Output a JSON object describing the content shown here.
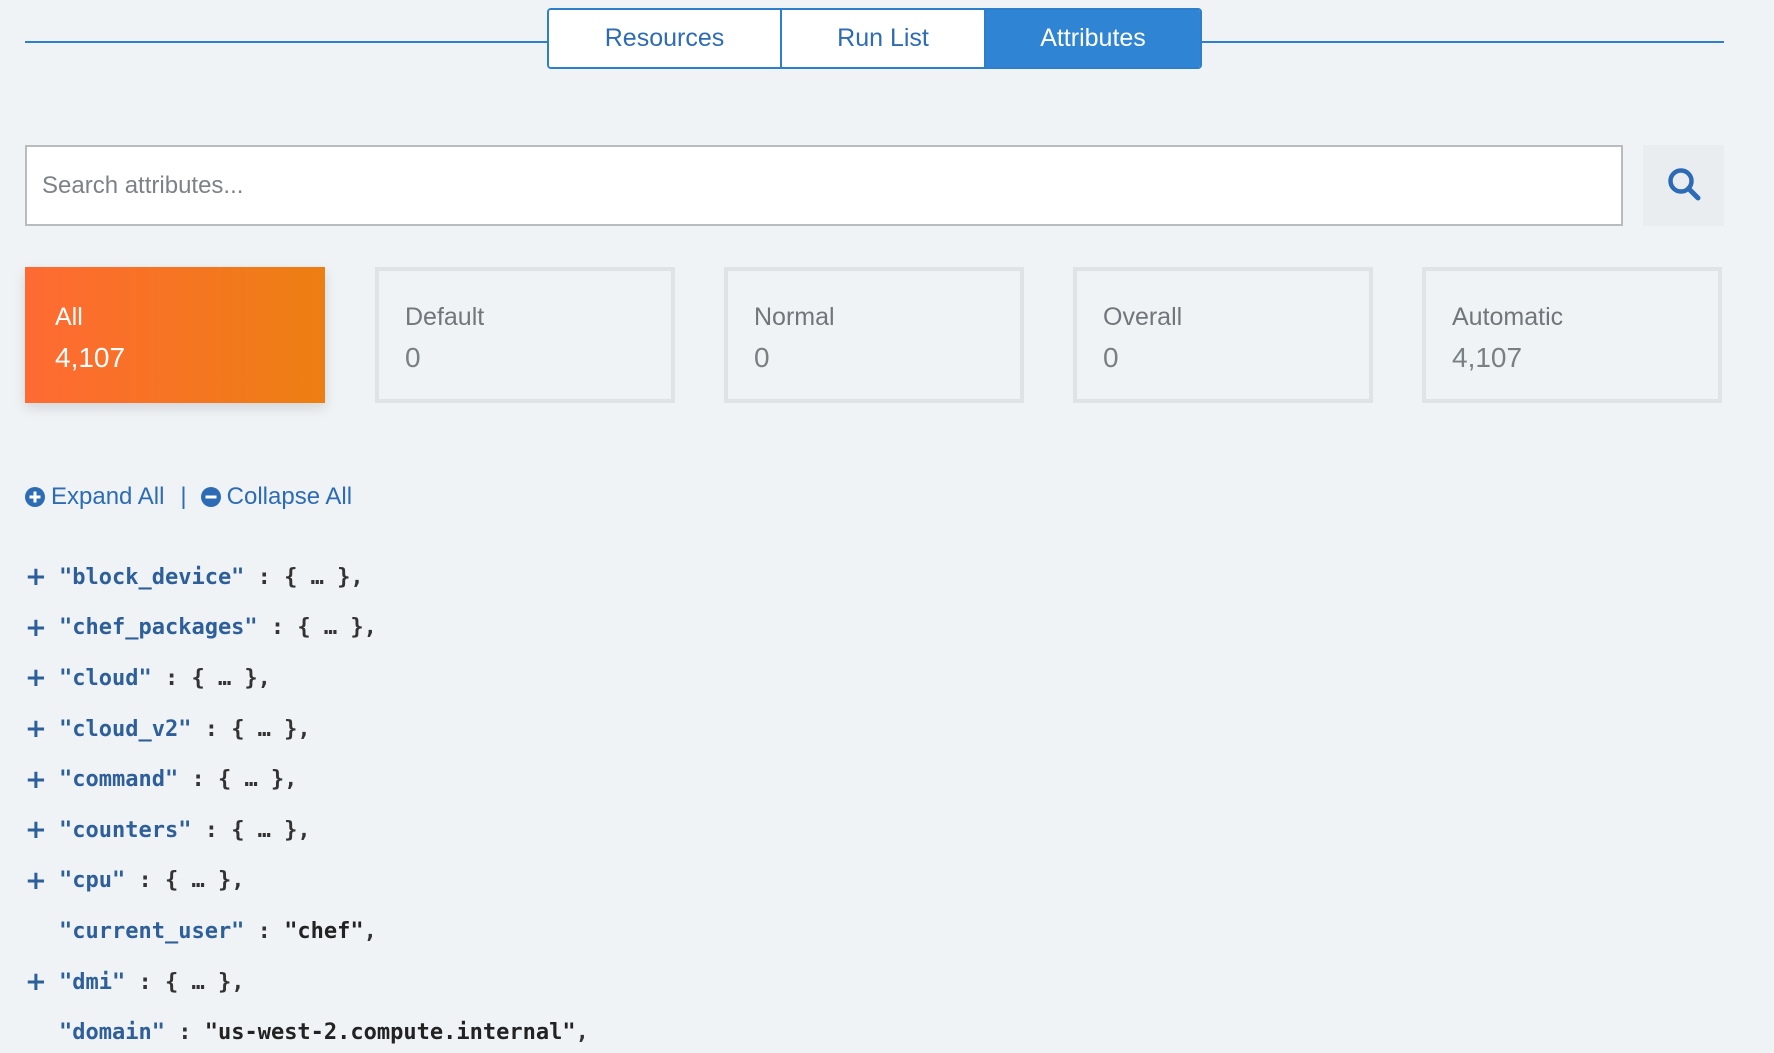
{
  "tabs": [
    {
      "label": "Resources",
      "active": false
    },
    {
      "label": "Run List",
      "active": false
    },
    {
      "label": "Attributes",
      "active": true
    }
  ],
  "search": {
    "placeholder": "Search attributes...",
    "value": "",
    "icon": "search-icon"
  },
  "filters": [
    {
      "label": "All",
      "count": "4,107",
      "active": true
    },
    {
      "label": "Default",
      "count": "0",
      "active": false
    },
    {
      "label": "Normal",
      "count": "0",
      "active": false
    },
    {
      "label": "Overall",
      "count": "0",
      "active": false
    },
    {
      "label": "Automatic",
      "count": "4,107",
      "active": false
    }
  ],
  "controls": {
    "expand_label": "Expand All",
    "collapse_label": "Collapse All",
    "separator": "|"
  },
  "attributes": [
    {
      "toggle": "+",
      "key": "\"block_device\"",
      "rest": " : { … },"
    },
    {
      "toggle": "+",
      "key": "\"chef_packages\"",
      "rest": " : { … },"
    },
    {
      "toggle": "+",
      "key": "\"cloud\"",
      "rest": " : { … },"
    },
    {
      "toggle": "+",
      "key": "\"cloud_v2\"",
      "rest": " : { … },"
    },
    {
      "toggle": "+",
      "key": "\"command\"",
      "rest": " : { … },"
    },
    {
      "toggle": "+",
      "key": "\"counters\"",
      "rest": " : { … },"
    },
    {
      "toggle": "+",
      "key": "\"cpu\"",
      "rest": " : { … },"
    },
    {
      "toggle": "",
      "key": "\"current_user\"",
      "rest": " : ",
      "value": "\"chef\"",
      "tail": ","
    },
    {
      "toggle": "+",
      "key": "\"dmi\"",
      "rest": " : { … },"
    },
    {
      "toggle": "",
      "key": "\"domain\"",
      "rest": " : ",
      "value": "\"us-west-2.compute.internal\"",
      "tail": ","
    }
  ],
  "colors": {
    "accent": "#2f84d3",
    "active_card_start": "#ff6a33",
    "active_card_end": "#ed7f12"
  }
}
